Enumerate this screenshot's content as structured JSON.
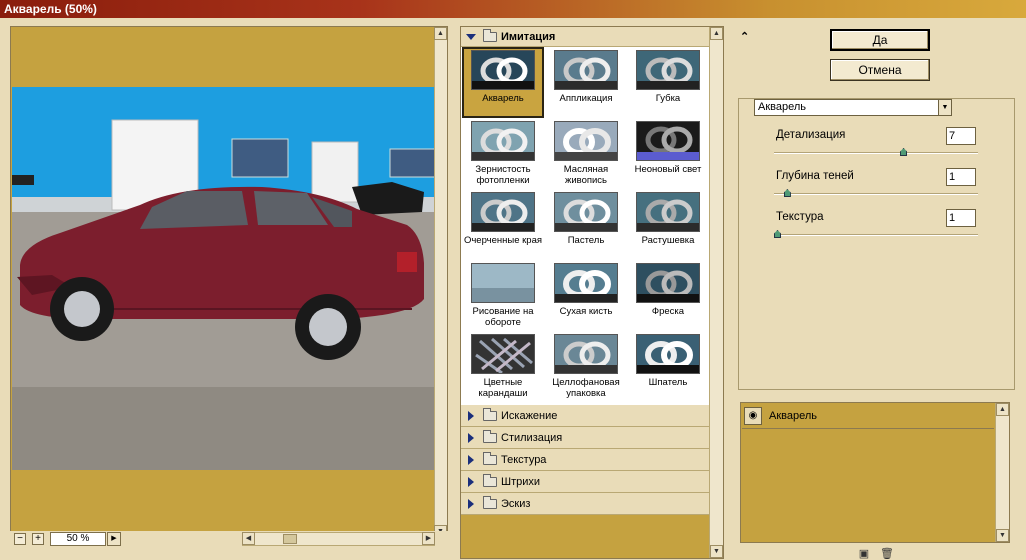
{
  "window": {
    "title": "Акварель (50%)"
  },
  "preview": {
    "zoom_minus": "−",
    "zoom_plus": "+",
    "zoom": "50 %"
  },
  "gallery": {
    "open_category": "Имитация",
    "filters": [
      {
        "label": "Акварель",
        "selected": true
      },
      {
        "label": "Аппликация"
      },
      {
        "label": "Губка"
      },
      {
        "label": "Зернистость фотопленки"
      },
      {
        "label": "Масляная живопись"
      },
      {
        "label": "Неоновый свет"
      },
      {
        "label": "Очерченные края"
      },
      {
        "label": "Пастель"
      },
      {
        "label": "Растушевка"
      },
      {
        "label": "Рисование на обороте"
      },
      {
        "label": "Сухая кисть"
      },
      {
        "label": "Фреска"
      },
      {
        "label": "Цветные карандаши"
      },
      {
        "label": "Целлофановая упаковка"
      },
      {
        "label": "Шпатель"
      }
    ],
    "categories": [
      "Искажение",
      "Стилизация",
      "Текстура",
      "Штрихи",
      "Эскиз"
    ]
  },
  "buttons": {
    "ok": "Да",
    "cancel": "Отмена"
  },
  "settings": {
    "filter_select": "Акварель",
    "params": [
      {
        "label": "Детализация",
        "value": "7",
        "level": 0.64
      },
      {
        "label": "Глубина теней",
        "value": "1",
        "level": 0.05
      },
      {
        "label": "Текстура",
        "value": "1",
        "level": 0.0
      }
    ]
  },
  "layers": {
    "items": [
      {
        "name": "Акварель"
      }
    ]
  },
  "colors": {
    "title_start": "#8a1d0c",
    "title_end": "#d8a93c",
    "panel": "#e9dcb8",
    "frame": "#c5a240",
    "wall": "#1d9ee0",
    "car": "#7c1e2d"
  }
}
